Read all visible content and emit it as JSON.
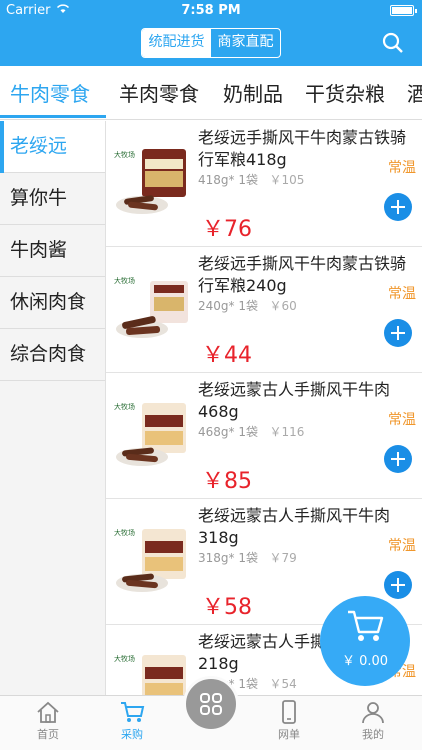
{
  "status": {
    "carrier": "Carrier",
    "time": "7:58 PM"
  },
  "header": {
    "seg_left": "统配进货",
    "seg_right": "商家直配"
  },
  "categories": [
    "牛肉零食",
    "羊肉零食",
    "奶制品",
    "干货杂粮",
    "酒"
  ],
  "brands": [
    "老绥远",
    "算你牛",
    "牛肉酱",
    "休闲肉食",
    "综合肉食"
  ],
  "products": [
    {
      "name": "老绥远手撕风干牛肉蒙古铁骑行军粮418g",
      "spec": "418g* 1袋",
      "orig": "￥105",
      "temp": "常温",
      "price": "￥76"
    },
    {
      "name": "老绥远手撕风干牛肉蒙古铁骑行军粮240g",
      "spec": "240g* 1袋",
      "orig": "￥60",
      "temp": "常温",
      "price": "￥44"
    },
    {
      "name": "老绥远蒙古人手撕风干牛肉468g",
      "spec": "468g* 1袋",
      "orig": "￥116",
      "temp": "常温",
      "price": "￥85"
    },
    {
      "name": "老绥远蒙古人手撕风干牛肉318g",
      "spec": "318g* 1袋",
      "orig": "￥79",
      "temp": "常温",
      "price": "￥58"
    },
    {
      "name": "老绥远蒙古人手撕风干牛肉218g",
      "spec": "218g* 1袋",
      "orig": "￥54",
      "temp": "常温",
      "price": ""
    }
  ],
  "cart": {
    "amount": "￥ 0.00"
  },
  "tabs": [
    "首页",
    "采购",
    "网单",
    "我的"
  ],
  "colors": {
    "accent": "#2da6f0",
    "price": "#e8232b",
    "temp": "#f0972c"
  }
}
